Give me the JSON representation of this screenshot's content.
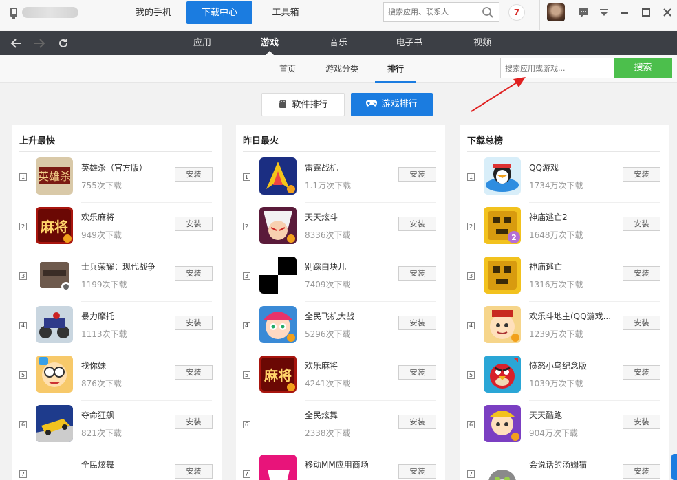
{
  "titlebar": {
    "tabs": [
      "我的手机",
      "下载中心",
      "工具箱"
    ],
    "active_tab": 1,
    "search_placeholder": "搜索应用、联系人",
    "badge": "7"
  },
  "nav": {
    "categories": [
      "应用",
      "游戏",
      "音乐",
      "电子书",
      "视频"
    ],
    "active_category": 1
  },
  "subnav": {
    "items": [
      "首页",
      "游戏分类",
      "排行"
    ],
    "active": 2,
    "search_placeholder": "搜索应用或游戏...",
    "search_button": "搜索"
  },
  "toggle": {
    "software": "软件排行",
    "games": "游戏排行"
  },
  "install_label": "安装",
  "panels": [
    {
      "title": "上升最快",
      "items": [
        {
          "rank": "1",
          "name": "英雄杀（官方版）",
          "downloads": "755次下载",
          "icon": "hero-kill-icon"
        },
        {
          "rank": "2",
          "name": "欢乐麻将",
          "downloads": "949次下载",
          "icon": "mahjong-icon"
        },
        {
          "rank": "3",
          "name": "士兵荣耀：现代战争",
          "downloads": "1199次下载",
          "icon": "soldier-glory-icon"
        },
        {
          "rank": "4",
          "name": "暴力摩托",
          "downloads": "1113次下载",
          "icon": "moto-icon"
        },
        {
          "rank": "5",
          "name": "找你妹",
          "downloads": "876次下载",
          "icon": "find-sister-icon"
        },
        {
          "rank": "6",
          "name": "夺命狂飙",
          "downloads": "821次下载",
          "icon": "racing-icon"
        },
        {
          "rank": "7",
          "name": "全民炫舞",
          "downloads": "",
          "icon": "dance-icon"
        }
      ]
    },
    {
      "title": "昨日最火",
      "items": [
        {
          "rank": "1",
          "name": "雷霆战机",
          "downloads": "1.1万次下载",
          "icon": "thunder-fighter-icon"
        },
        {
          "rank": "2",
          "name": "天天炫斗",
          "downloads": "8336次下载",
          "icon": "daily-fight-icon"
        },
        {
          "rank": "3",
          "name": "别踩白块儿",
          "downloads": "7409次下载",
          "icon": "piano-tiles-icon"
        },
        {
          "rank": "4",
          "name": "全民飞机大战",
          "downloads": "5296次下载",
          "icon": "plane-war-icon"
        },
        {
          "rank": "5",
          "name": "欢乐麻将",
          "downloads": "4241次下载",
          "icon": "mahjong-icon"
        },
        {
          "rank": "6",
          "name": "全民炫舞",
          "downloads": "2338次下载",
          "icon": "dance-icon"
        },
        {
          "rank": "7",
          "name": "移动MM应用商场",
          "downloads": "",
          "icon": "mm-store-icon"
        }
      ]
    },
    {
      "title": "下载总榜",
      "items": [
        {
          "rank": "1",
          "name": "QQ游戏",
          "downloads": "1734万次下载",
          "icon": "qq-game-icon"
        },
        {
          "rank": "2",
          "name": "神庙逃亡2",
          "downloads": "1648万次下载",
          "icon": "temple-run-2-icon"
        },
        {
          "rank": "3",
          "name": "神庙逃亡",
          "downloads": "1316万次下载",
          "icon": "temple-run-icon"
        },
        {
          "rank": "4",
          "name": "欢乐斗地主(QQ游戏...",
          "downloads": "1239万次下载",
          "icon": "landlord-icon"
        },
        {
          "rank": "5",
          "name": "愤怒小鸟纪念版",
          "downloads": "1039万次下载",
          "icon": "angry-birds-icon"
        },
        {
          "rank": "6",
          "name": "天天酷跑",
          "downloads": "904万次下载",
          "icon": "daily-run-icon"
        },
        {
          "rank": "7",
          "name": "会说话的汤姆猫",
          "downloads": "",
          "icon": "talking-tom-icon"
        }
      ]
    }
  ],
  "colors": {
    "accent": "#1b7ce0",
    "search_green": "#4cbf4c",
    "dark_nav": "#3c3f45",
    "annotation_arrow": "#e02020"
  }
}
